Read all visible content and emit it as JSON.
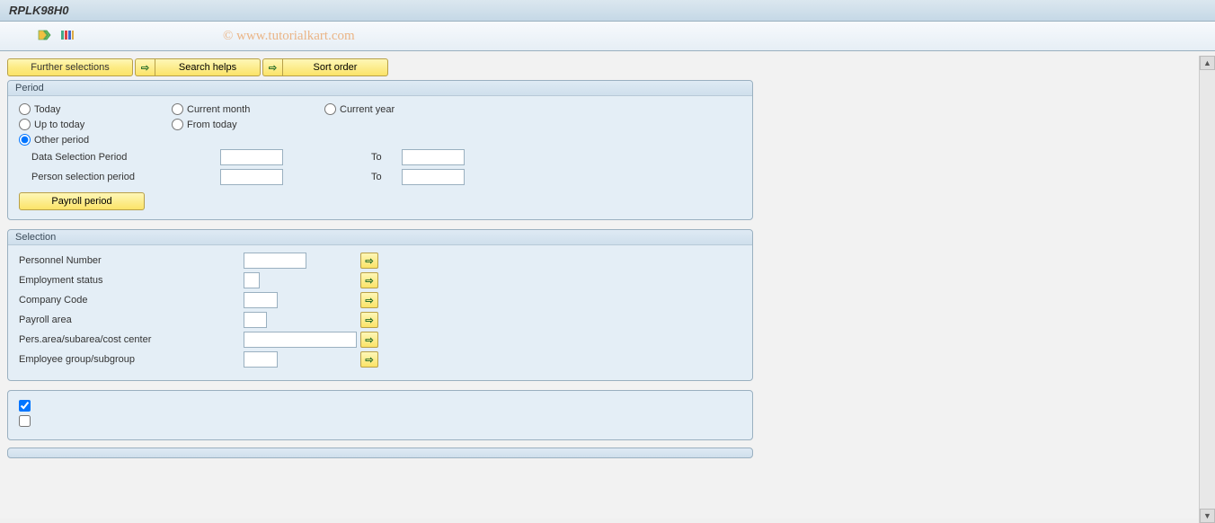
{
  "title": "RPLK98H0",
  "watermark": "© www.tutorialkart.com",
  "buttons": {
    "further_selections": "Further selections",
    "search_helps": "Search helps",
    "sort_order": "Sort order"
  },
  "period": {
    "legend": "Period",
    "today": "Today",
    "current_month": "Current month",
    "current_year": "Current year",
    "up_to_today": "Up to today",
    "from_today": "From today",
    "other_period": "Other period",
    "data_selection_period": "Data Selection Period",
    "person_selection_period": "Person selection period",
    "to": "To",
    "payroll_period": "Payroll period",
    "data_from": "",
    "data_to": "",
    "person_from": "",
    "person_to": ""
  },
  "selection": {
    "legend": "Selection",
    "personnel_number": "Personnel Number",
    "employment_status": "Employment status",
    "company_code": "Company Code",
    "payroll_area": "Payroll area",
    "pers_area": "Pers.area/subarea/cost center",
    "employee_group": "Employee group/subgroup",
    "val_personnel": "",
    "val_employment": "",
    "val_company": "",
    "val_payroll": "",
    "val_persarea": "",
    "val_empgroup": ""
  },
  "checkbox1": true,
  "checkbox2": false
}
